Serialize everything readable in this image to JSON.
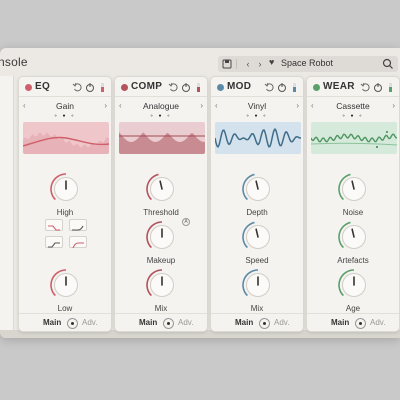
{
  "app": {
    "title": "nsole"
  },
  "preset": {
    "name": "Space Robot",
    "save_icon": "save-icon",
    "prev": "‹",
    "next": "›",
    "heart": "♥",
    "search_icon": "search-icon"
  },
  "colors": {
    "eq": "#cf5f6a",
    "comp": "#b4535d",
    "mod": "#5b8aa8",
    "wear": "#5aa06b"
  },
  "modules": [
    {
      "key": "eq",
      "name": "EQ",
      "variant": "Gain",
      "knobs": [
        {
          "label": "High",
          "value": 0.5
        },
        {
          "label": "Low",
          "value": 0.5
        }
      ]
    },
    {
      "key": "comp",
      "name": "COMP",
      "variant": "Analogue",
      "knobs": [
        {
          "label": "Threshold",
          "value": 0.45
        },
        {
          "label": "Makeup",
          "value": 0.5
        },
        {
          "label": "Mix",
          "value": 0.5
        }
      ]
    },
    {
      "key": "mod",
      "name": "MOD",
      "variant": "Vinyl",
      "knobs": [
        {
          "label": "Depth",
          "value": 0.45
        },
        {
          "label": "Speed",
          "value": 0.45
        },
        {
          "label": "Mix",
          "value": 0.5
        }
      ]
    },
    {
      "key": "wear",
      "name": "WEAR",
      "variant": "Cassette",
      "knobs": [
        {
          "label": "Noise",
          "value": 0.45
        },
        {
          "label": "Artefacts",
          "value": 0.45
        },
        {
          "label": "Age",
          "value": 0.5
        }
      ]
    }
  ],
  "footer": {
    "main": "Main",
    "adv": "Adv."
  },
  "auto_badge": "A"
}
